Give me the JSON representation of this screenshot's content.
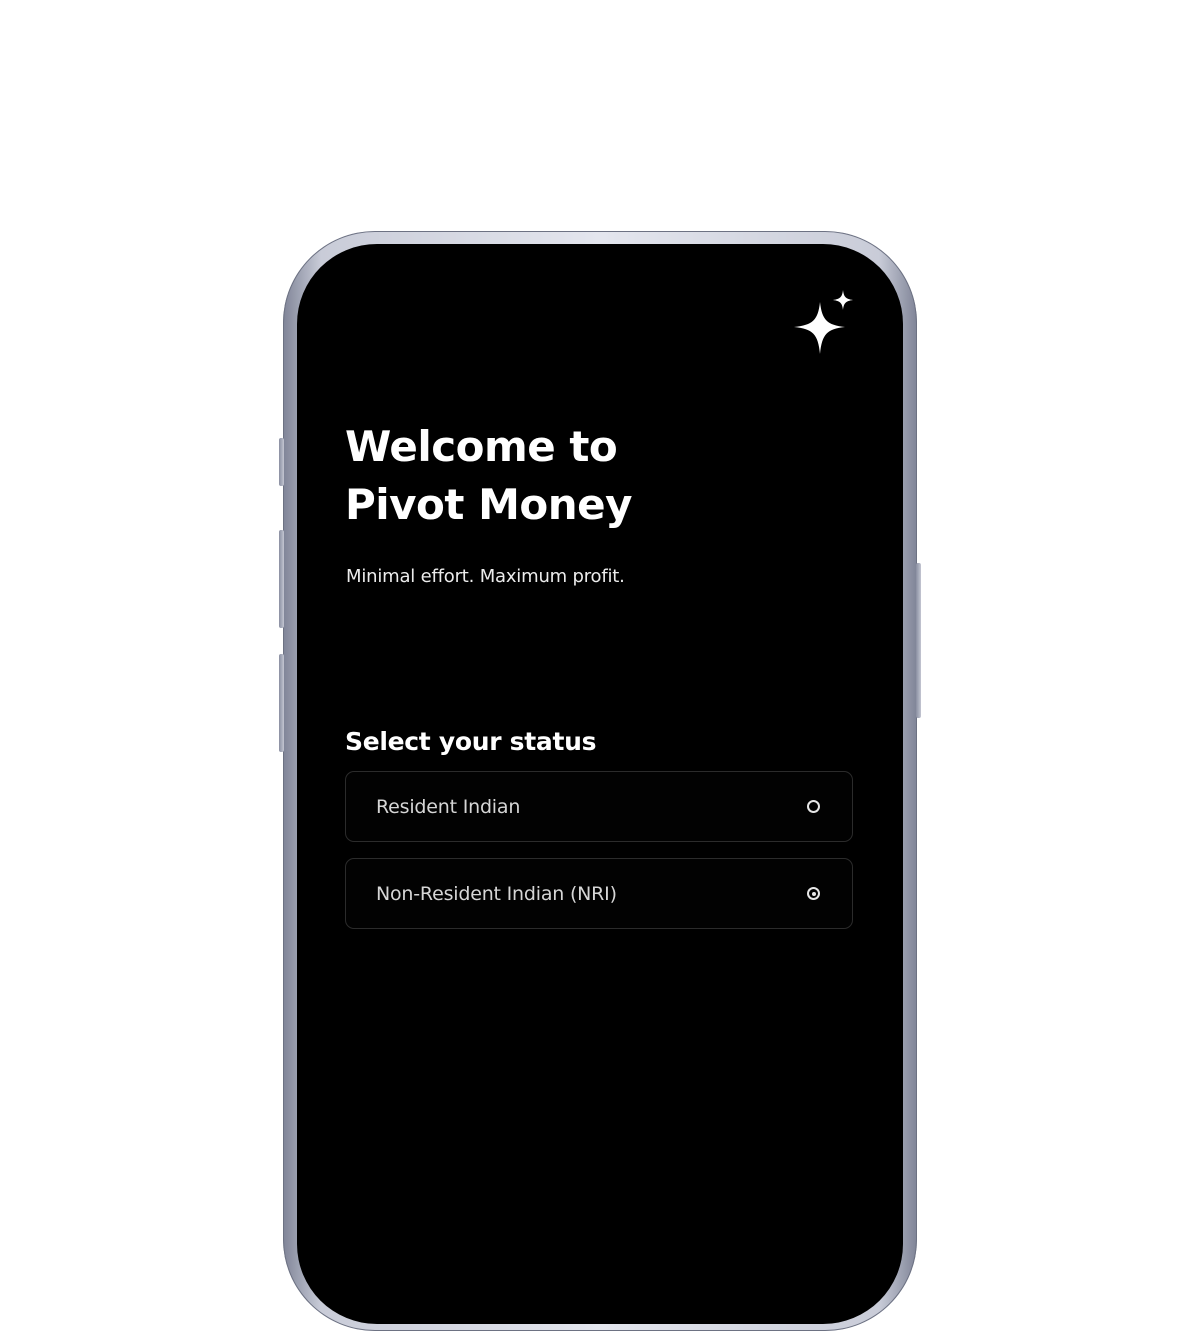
{
  "app": {
    "title_line1": "Welcome to",
    "title_line2": "Pivot Money",
    "tagline": "Minimal effort. Maximum profit.",
    "brand_icon": "sparkle-icon"
  },
  "status_selector": {
    "heading": "Select your status",
    "selected_index": 1,
    "options": [
      {
        "label": "Resident Indian",
        "selected": false
      },
      {
        "label": "Non-Resident Indian (NRI)",
        "selected": true
      }
    ]
  },
  "colors": {
    "screen_background": "#000000",
    "text_primary": "#ffffff",
    "option_border": "#2b2b2b"
  }
}
